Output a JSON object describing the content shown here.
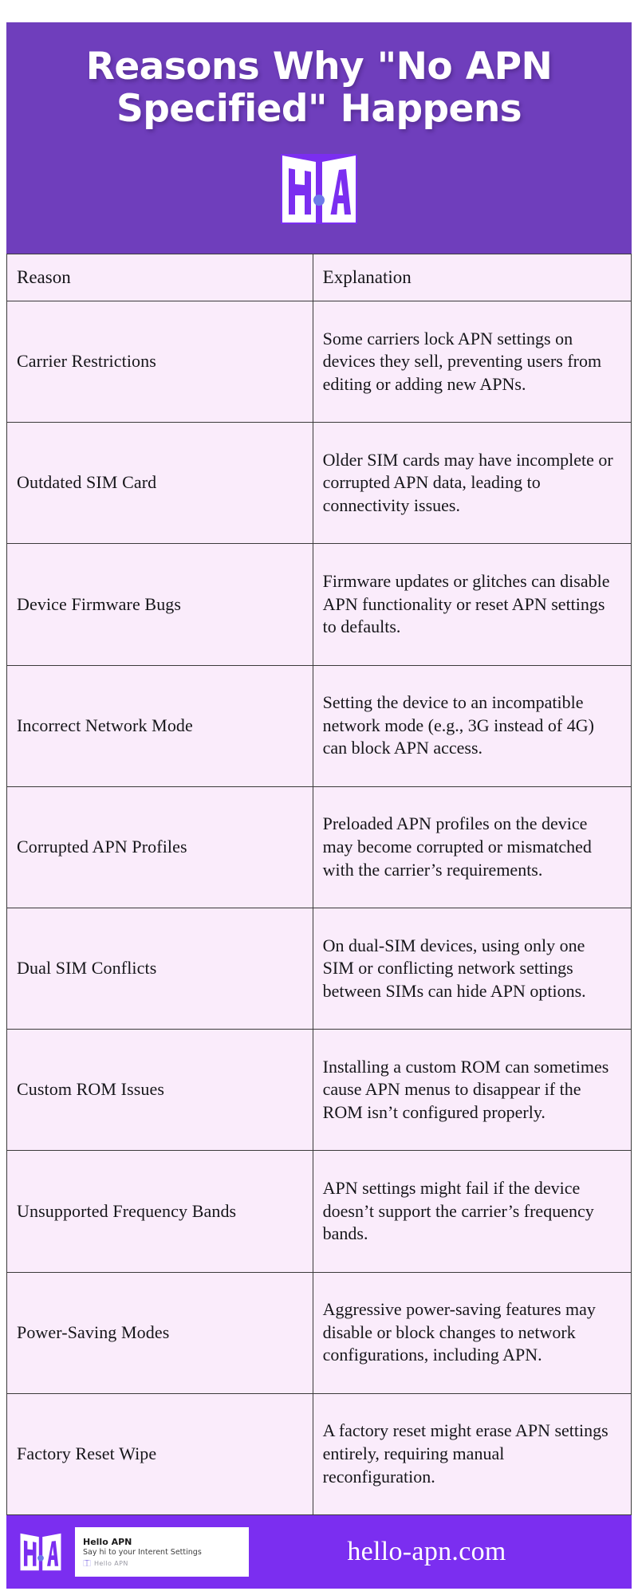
{
  "header": {
    "title": "Reasons Why \"No APN Specified\" Happens",
    "background_color": "#6F3EBC",
    "logo": {
      "name": "hello-apn-monogram",
      "letters": "H·A",
      "tile_color": "#7B2EF0",
      "letter_color": "#ffffff",
      "dot_color": "#6C7BE8"
    }
  },
  "table": {
    "background_color": "#FAECFB",
    "border_color": "#3a3a3a",
    "columns": [
      "Reason",
      "Explanation"
    ],
    "rows": [
      {
        "reason": "Carrier Restrictions",
        "explanation": "Some carriers lock APN settings on devices they sell, preventing users from editing or adding new APNs."
      },
      {
        "reason": "Outdated SIM Card",
        "explanation": "Older SIM cards may have incomplete or corrupted APN data, leading to connectivity issues."
      },
      {
        "reason": "Device Firmware Bugs",
        "explanation": "Firmware updates or glitches can disable APN functionality or reset APN settings to defaults."
      },
      {
        "reason": "Incorrect Network Mode",
        "explanation": "Setting the device to an incompatible network mode (e.g., 3G instead of 4G) can block APN access."
      },
      {
        "reason": "Corrupted APN Profiles",
        "explanation": "Preloaded APN profiles on the device may become corrupted or mismatched with the carrier’s requirements."
      },
      {
        "reason": "Dual SIM Conflicts",
        "explanation": "On dual-SIM devices, using only one SIM or conflicting network settings between SIMs can hide APN options."
      },
      {
        "reason": "Custom ROM Issues",
        "explanation": "Installing a custom ROM can sometimes cause APN menus to disappear if the ROM isn’t configured properly."
      },
      {
        "reason": "Unsupported Frequency Bands",
        "explanation": "APN settings might fail if the device doesn’t support the carrier’s frequency bands."
      },
      {
        "reason": "Power-Saving Modes",
        "explanation": "Aggressive power-saving features may disable or block changes to network configurations, including APN."
      },
      {
        "reason": "Factory Reset Wipe",
        "explanation": "A factory reset might erase APN settings entirely, requiring manual reconfiguration."
      }
    ]
  },
  "footer": {
    "background_color": "#7B2EF0",
    "logo_name": "hello-apn-monogram",
    "card": {
      "title": "Hello APN",
      "subtitle": "Say hi to your Interent Settings",
      "badge_label": "Hello  APN"
    },
    "url": "hello-apn.com"
  }
}
